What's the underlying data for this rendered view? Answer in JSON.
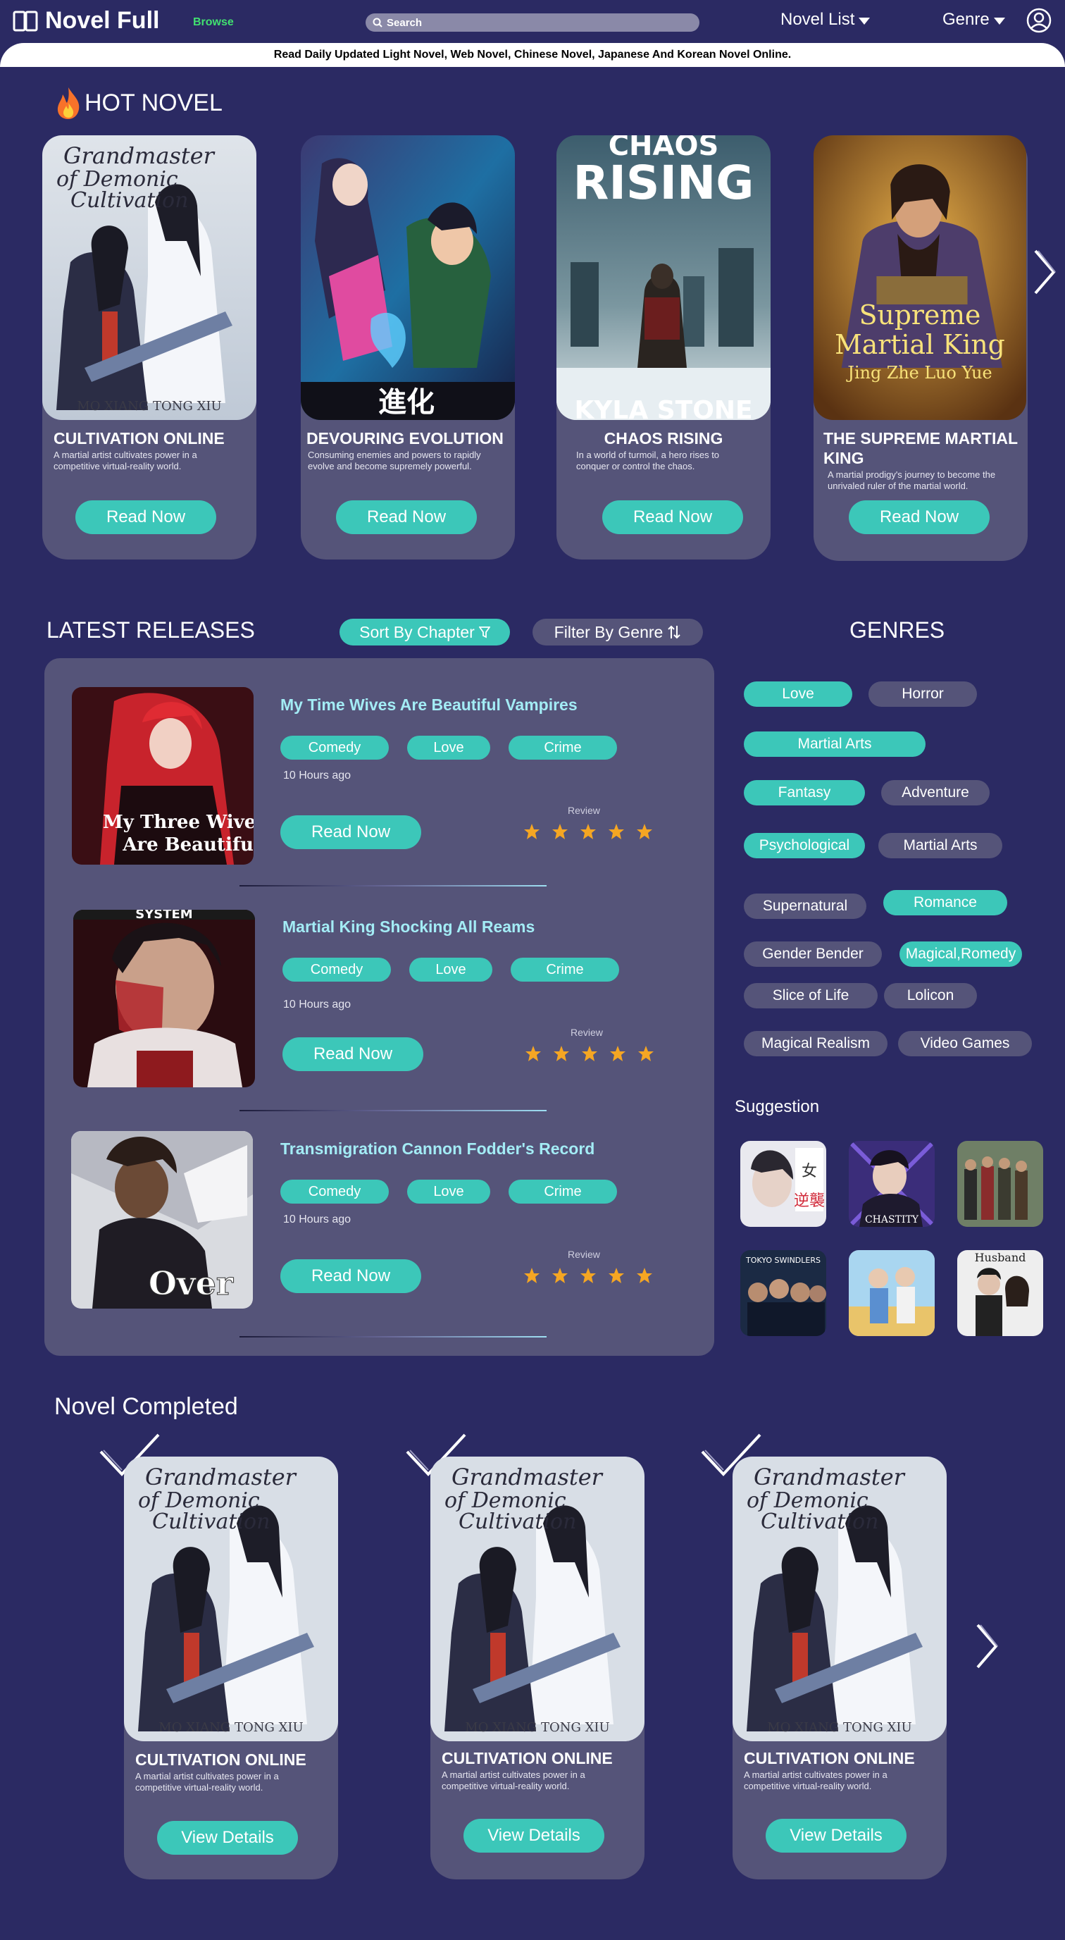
{
  "header": {
    "logo_text": "Novel Full",
    "browse_label": "Browse",
    "search_placeholder": "Search",
    "nav_novel_list": "Novel List",
    "nav_genre": "Genre",
    "banner_text": "Read Daily Updated Light Novel, Web Novel, Chinese Novel, Japanese And Korean Novel Online."
  },
  "hot_novel": {
    "title": "HOT NOVEL",
    "cards": [
      {
        "title": "CULTIVATION ONLINE",
        "desc": "A martial artist cultivates power in a competitive virtual-reality world.",
        "button": "Read Now",
        "cover_title": "Grandmaster of Demonic Cultivation",
        "cover_author": "MO XIANG TONG XIU"
      },
      {
        "title": "DEVOURING EVOLUTION",
        "desc": "Consuming enemies and powers to rapidly evolve and become supremely powerful.",
        "button": "Read Now",
        "cover_title": "",
        "cover_author": ""
      },
      {
        "title": "CHAOS RISING",
        "desc": "In a world of turmoil, a hero rises to conquer or control the chaos.",
        "button": "Read Now",
        "cover_title": "CHAOS RISING",
        "cover_author": "KYLA STONE"
      },
      {
        "title": "THE SUPREME MARTIAL KING",
        "desc": "A martial prodigy's journey to become the unrivaled ruler of the martial world.",
        "button": "Read Now",
        "cover_title": "Supreme Martial King",
        "cover_author": "Jing Zhe Luo Yue"
      }
    ]
  },
  "latest": {
    "title": "LATEST RELEASES",
    "sort_label": "Sort By Chapter",
    "filter_label": "Filter By Genre",
    "review_label": "Review",
    "items": [
      {
        "title": "My Time Wives Are Beautiful Vampires",
        "tags": [
          "Comedy",
          "Love",
          "Crime"
        ],
        "time": "10 Hours ago",
        "button": "Read Now",
        "rating": 5,
        "cover_text": "My Three Wives Are Beautiful"
      },
      {
        "title": "Martial King Shocking All Reams",
        "tags": [
          "Comedy",
          "Love",
          "Crime"
        ],
        "time": "10 Hours ago",
        "button": "Read Now",
        "rating": 5,
        "cover_text": "SYSTEM"
      },
      {
        "title": "Transmigration Cannon Fodder's Record",
        "tags": [
          "Comedy",
          "Love",
          "Crime"
        ],
        "time": "10 Hours ago",
        "button": "Read Now",
        "rating": 5,
        "cover_text": "Over"
      }
    ]
  },
  "genres": {
    "title": "GENRES",
    "items": [
      "Love",
      "Horror",
      "Martial Arts",
      "Fantasy",
      "Adventure",
      "Psychological",
      "Martial Arts",
      "Supernatural",
      "Romance",
      "Gender Bender",
      "Magical,Romedy",
      "Slice of Life",
      "Lolicon",
      "Magical Realism",
      "Video Games"
    ]
  },
  "suggestion": {
    "title": "Suggestion",
    "captions": [
      "CHASTITY",
      "TOKYO SWINDLERS",
      "Husband"
    ]
  },
  "completed": {
    "title": "Novel Completed",
    "cards": [
      {
        "title": "CULTIVATION ONLINE",
        "desc": "A martial artist cultivates power in a competitive virtual-reality world.",
        "button": "View Details"
      },
      {
        "title": "CULTIVATION ONLINE",
        "desc": "A martial artist cultivates power in a competitive virtual-reality world.",
        "button": "View Details"
      },
      {
        "title": "CULTIVATION ONLINE",
        "desc": "A martial artist cultivates power in a competitive virtual-reality world.",
        "button": "View Details"
      }
    ]
  },
  "colors": {
    "background": "#2b2a63",
    "card": "#555479",
    "accent": "#3cc7b9",
    "browse": "#41e070",
    "title_highlight": "#a3ecf5",
    "star": "#f5a623"
  }
}
